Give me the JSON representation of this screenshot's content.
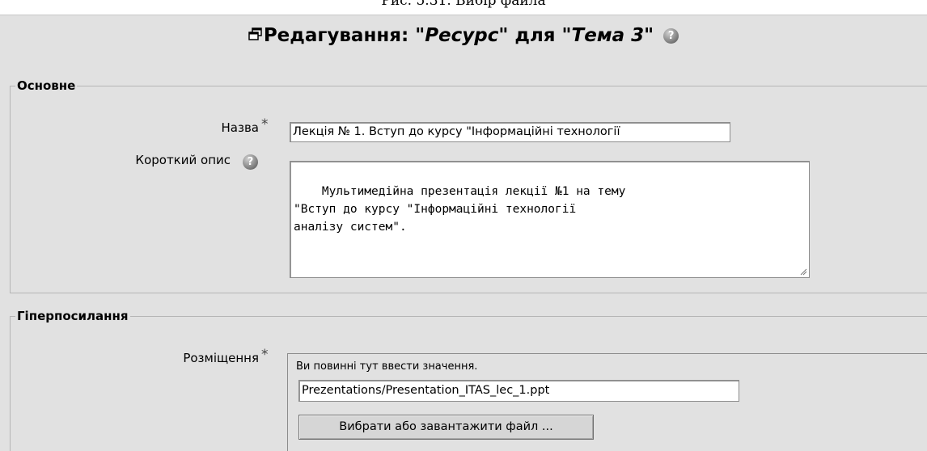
{
  "caption": "Рис. 5.31. Вибір файла",
  "header": {
    "prefix": "Редагування: \"",
    "resource": "Ресурс",
    "middle": "\" для \"",
    "topic": "Тема 3",
    "suffix": "\"",
    "window_icon": "window-icon",
    "help_icon": "help-icon"
  },
  "general": {
    "legend": "Основне",
    "name_label": "Назва",
    "name_value": "Лекція № 1. Вступ до курсу \"Інформаційні технології",
    "required_mark": "*",
    "summary_label": "Короткий опис",
    "summary_value": "Мультимедійна презентація лекції №1 на тему\n\"Вступ до курсу \"Інформаційні технології\nаналізу систем\"."
  },
  "hyperlink": {
    "legend": "Гіперпосилання",
    "location_label": "Розміщення",
    "required_mark": "*",
    "error_text": "Ви повинні тут ввести значення.",
    "location_value": "Prezentations/Presentation_ITAS_lec_1.ppt",
    "choose_button": "Вибрати або завантажити файл ..."
  }
}
